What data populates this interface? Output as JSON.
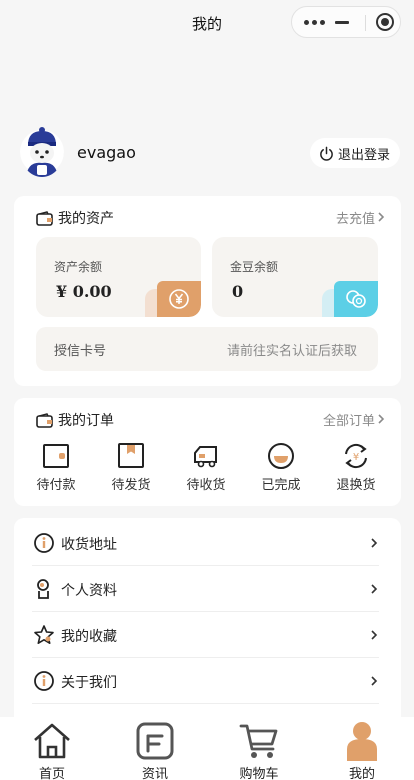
{
  "nav": {
    "title": "我的"
  },
  "profile": {
    "username": "evagao",
    "logout_label": "退出登录"
  },
  "assets": {
    "title": "我的资产",
    "recharge_label": "去充值",
    "balance": {
      "label": "资产余额",
      "value": "¥ 0.00"
    },
    "gold": {
      "label": "金豆余额",
      "value": "0"
    },
    "credit_card": {
      "label": "授信卡号",
      "hint": "请前往实名认证后获取"
    }
  },
  "orders": {
    "title": "我的订单",
    "all_label": "全部订单",
    "items": [
      {
        "label": "待付款",
        "icon": "wallet-icon"
      },
      {
        "label": "待发货",
        "icon": "box-icon"
      },
      {
        "label": "待收货",
        "icon": "truck-icon"
      },
      {
        "label": "已完成",
        "icon": "done-icon"
      },
      {
        "label": "退换货",
        "icon": "refund-icon"
      }
    ]
  },
  "menu": {
    "items": [
      {
        "label": "收货地址",
        "icon": "info-icon"
      },
      {
        "label": "个人资料",
        "icon": "user-icon"
      },
      {
        "label": "我的收藏",
        "icon": "star-icon"
      },
      {
        "label": "关于我们",
        "icon": "info-icon"
      }
    ]
  },
  "tabbar": {
    "items": [
      {
        "label": "首页",
        "icon": "home-icon"
      },
      {
        "label": "资讯",
        "icon": "news-icon"
      },
      {
        "label": "购物车",
        "icon": "cart-icon"
      },
      {
        "label": "我的",
        "icon": "profile-icon"
      }
    ]
  },
  "colors": {
    "accent_orange": "#e0a06a",
    "accent_teal": "#5ccfe6",
    "background": "#f6f6f6",
    "card": "#ffffff"
  }
}
